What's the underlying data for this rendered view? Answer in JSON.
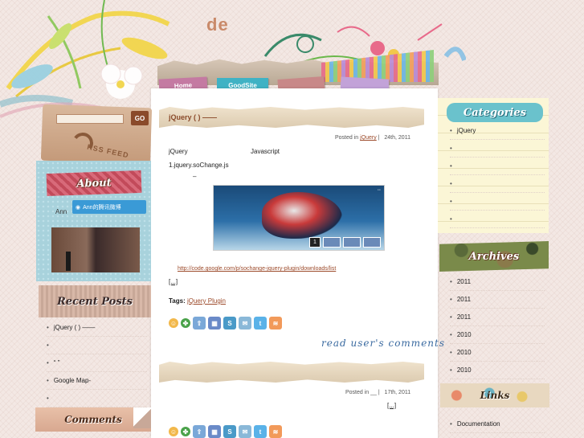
{
  "header": {
    "site_title": "de"
  },
  "nav": {
    "tabs": [
      {
        "label": "Home"
      },
      {
        "label": "GoodSite"
      },
      {
        "label": ""
      },
      {
        "label": ""
      }
    ]
  },
  "sidebar_left": {
    "search": {
      "placeholder": "",
      "go_label": "GO"
    },
    "rss_label": "RSS FEED",
    "about": {
      "heading": "About",
      "name": "Ann",
      "weibo_label": "Ann的腾讯微博"
    },
    "recent_posts": {
      "heading": "Recent Posts",
      "items": [
        "jQuery     ( ) ——",
        "",
        "“ ”",
        "Google Map-",
        ""
      ]
    },
    "comments": {
      "heading": "Comments"
    }
  },
  "post1": {
    "title": "jQuery       ( ) ——",
    "meta_prefix": "Posted in",
    "category": "jQuery",
    "separator": "|",
    "date": "24th, 2011",
    "line1_left": "jQuery",
    "line1_right": "Javascript",
    "line2": "1.jquery.soChange.js",
    "line3": "–",
    "image_dots": "◦◦",
    "image_thumb_num": "1",
    "url": "http://code.google.com/p/sochange-jquery-plugin/downloads/list",
    "more": "[...]",
    "tags_label": "Tags:",
    "tag": "jQuery Plugin",
    "read_comments": "read user's comments"
  },
  "post2": {
    "meta_prefix": "Posted in",
    "category": "",
    "separator": "|",
    "date": "17th, 2011",
    "more": "[...]"
  },
  "share_icons": [
    {
      "icon": "smiley-icon",
      "color": "#f2b84b",
      "glyph": "☺"
    },
    {
      "icon": "clover-icon",
      "color": "#4aa24a",
      "glyph": "✤"
    },
    {
      "icon": "arrow-icon",
      "color": "#7aa8d8",
      "glyph": "⇧"
    },
    {
      "icon": "delicious-icon",
      "color": "#6a8ac8",
      "glyph": "▦"
    },
    {
      "icon": "stumbleupon-icon",
      "color": "#4a9ac8",
      "glyph": "S"
    },
    {
      "icon": "mail-icon",
      "color": "#8ab8d8",
      "glyph": "✉"
    },
    {
      "icon": "twitter-icon",
      "color": "#5ab2e8",
      "glyph": "t"
    },
    {
      "icon": "rss-icon",
      "color": "#f29a5a",
      "glyph": "≋"
    }
  ],
  "sidebar_right": {
    "categories": {
      "heading": "Categories",
      "items": [
        "jQuery",
        "",
        "",
        "",
        "",
        ""
      ]
    },
    "archives": {
      "heading": "Archives",
      "items": [
        "2011",
        "2011",
        "2011",
        "2010",
        "2010",
        "2010"
      ]
    },
    "links": {
      "heading": "Links",
      "items": [
        "Documentation"
      ]
    }
  }
}
